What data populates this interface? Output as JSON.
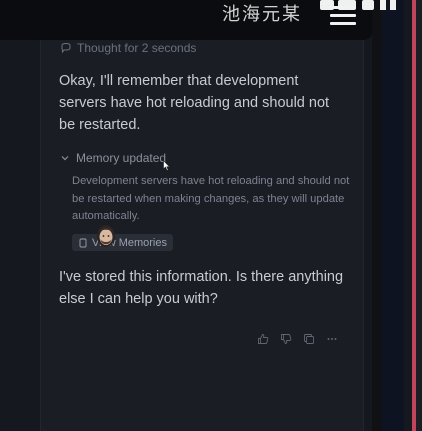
{
  "watermark": {
    "text": "池海元某",
    "logo_label": "Bili"
  },
  "thought": {
    "label": "Thought for 2 seconds",
    "icon": "thought-bubble-icon"
  },
  "messages": {
    "first": "Okay, I'll remember that development servers have hot reloading and should not be restarted.",
    "second": "I've stored this information. Is there anything else I can help you with?"
  },
  "memory": {
    "header_label": "Memory updated",
    "header_icon": "chevron-down-icon",
    "body": "Development servers have hot reloading and should not be restarted when making changes, as they will update automatically.",
    "view_button_label": "View Memories",
    "view_button_icon": "document-icon"
  },
  "actions": [
    {
      "name": "thumbs-up-icon"
    },
    {
      "name": "thumbs-down-icon"
    },
    {
      "name": "copy-icon"
    },
    {
      "name": "more-icon"
    }
  ],
  "colors": {
    "background": "#15181e",
    "panel": "#1a1d24",
    "text_primary": "#c7cbd3",
    "text_muted": "#7d8390",
    "accent_red": "#c0455a"
  }
}
